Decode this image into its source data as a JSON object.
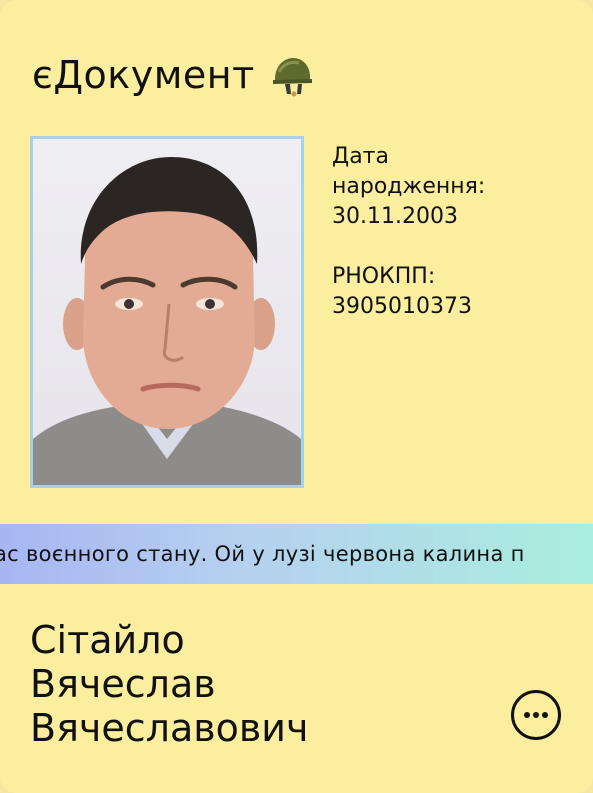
{
  "header": {
    "title": "єДокумент",
    "badge_icon": "helmet-icon"
  },
  "info": {
    "birth_label": "Дата народження:",
    "birth_value": "30.11.2003",
    "tax_label": "РНОКПП:",
    "tax_value": "3905010373"
  },
  "ticker": {
    "text": "ас воєнного стану. Ой у лузі червона калина п"
  },
  "person": {
    "surname": "Сітайло",
    "first_name": "Вячеслав",
    "patronymic": "Вячеславович"
  },
  "actions": {
    "more_icon": "more-dots-icon"
  },
  "colors": {
    "card_bg": "#fbee9f",
    "photo_border": "#a9cfe9",
    "ticker_start": "#a7b6f2",
    "ticker_end": "#a9eede"
  }
}
